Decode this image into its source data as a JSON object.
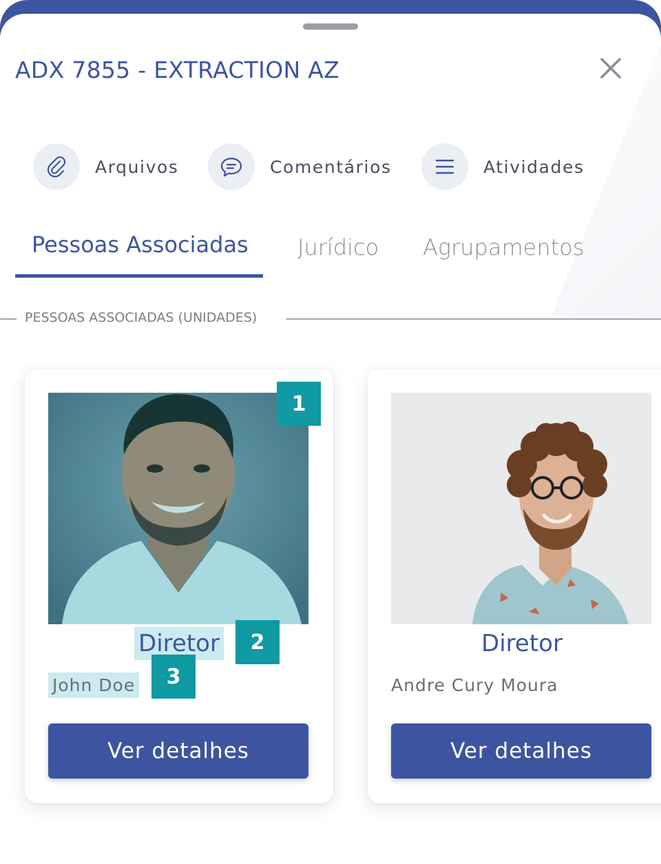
{
  "header": {
    "title": "ADX 7855 - EXTRACTION AZ",
    "close_icon": "close-icon"
  },
  "actions": [
    {
      "label": "Arquivos",
      "icon": "paperclip-icon"
    },
    {
      "label": "Comentários",
      "icon": "comment-icon"
    },
    {
      "label": "Atividades",
      "icon": "list-icon"
    }
  ],
  "tabs": [
    {
      "label": "Pessoas Associadas",
      "active": true
    },
    {
      "label": "Jurídico",
      "active": false
    },
    {
      "label": "Agrupamentos",
      "active": false
    }
  ],
  "section": {
    "title": "PESSOAS ASSOCIADAS (UNIDADES)"
  },
  "cards": [
    {
      "role": "Diretor",
      "name": "John Doe",
      "button": "Ver detalhes"
    },
    {
      "role": "Diretor",
      "name": "Andre Cury Moura",
      "button": "Ver detalhes"
    }
  ],
  "markers": [
    "1",
    "2",
    "3"
  ],
  "colors": {
    "brand": "#3d55a0",
    "marker": "#0f9aa4",
    "highlight": "#8cd2dc"
  }
}
